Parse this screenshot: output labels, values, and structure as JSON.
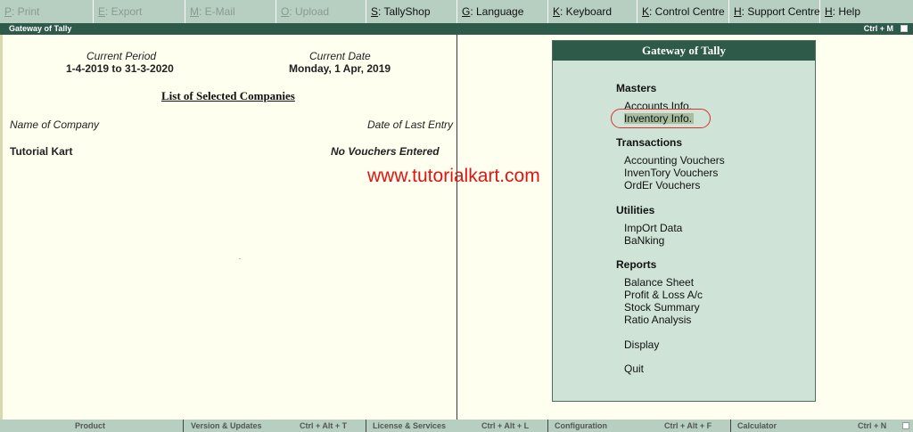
{
  "topbar": [
    {
      "key": "P",
      "label": ": Print",
      "enabled": false
    },
    {
      "key": "E",
      "label": ": Export",
      "enabled": false
    },
    {
      "key": "M",
      "label": ": E-Mail",
      "enabled": false
    },
    {
      "key": "O",
      "label": ": Upload",
      "enabled": false
    },
    {
      "key": "S",
      "label": ": TallyShop",
      "enabled": true
    },
    {
      "key": "G",
      "label": ": Language",
      "enabled": true
    },
    {
      "key": "K",
      "label": ": Keyboard",
      "enabled": true
    },
    {
      "key": "K",
      "label": ": Control Centre",
      "enabled": true
    },
    {
      "key": "H",
      "label": ": Support Centre",
      "enabled": true
    },
    {
      "key": "H",
      "label": ": Help",
      "enabled": true
    }
  ],
  "window": {
    "title": "Gateway of Tally",
    "shortcut": "Ctrl + M"
  },
  "period": {
    "label": "Current Period",
    "value": "1-4-2019 to 31-3-2020"
  },
  "date": {
    "label": "Current Date",
    "value": "Monday, 1 Apr, 2019"
  },
  "companies": {
    "title": "List of Selected Companies",
    "col_name": "Name of Company",
    "col_date": "Date of Last Entry",
    "rows": [
      {
        "name": "Tutorial Kart",
        "last_entry": "No Vouchers Entered"
      }
    ]
  },
  "gateway": {
    "title": "Gateway of Tally",
    "masters": {
      "heading": "Masters",
      "items": [
        "Accounts Info.",
        "Inventory Info."
      ]
    },
    "transactions": {
      "heading": "Transactions",
      "items": [
        "Accounting Vouchers",
        "InvenTory Vouchers",
        "OrdEr Vouchers"
      ]
    },
    "utilities": {
      "heading": "Utilities",
      "items": [
        "ImpOrt Data",
        "BaNking"
      ]
    },
    "reports": {
      "heading": "Reports",
      "items": [
        "Balance Sheet",
        "Profit & Loss A/c",
        "Stock Summary",
        "Ratio Analysis"
      ]
    },
    "display": "Display",
    "quit": "Quit"
  },
  "watermark": "www.tutorialkart.com",
  "bottombar": {
    "product": "Product",
    "version": "Version & Updates",
    "version_shortcut": "Ctrl + Alt + T",
    "license": "License & Services",
    "license_shortcut": "Ctrl + Alt + L",
    "configuration": "Configuration",
    "configuration_shortcut": "Ctrl + Alt + F",
    "calculator": "Calculator",
    "calculator_shortcut": "Ctrl + N"
  },
  "colors": {
    "accent": "#2e5a4a",
    "panel": "#cfe4d6",
    "highlight_ring": "#d93030",
    "watermark": "#e01414"
  }
}
